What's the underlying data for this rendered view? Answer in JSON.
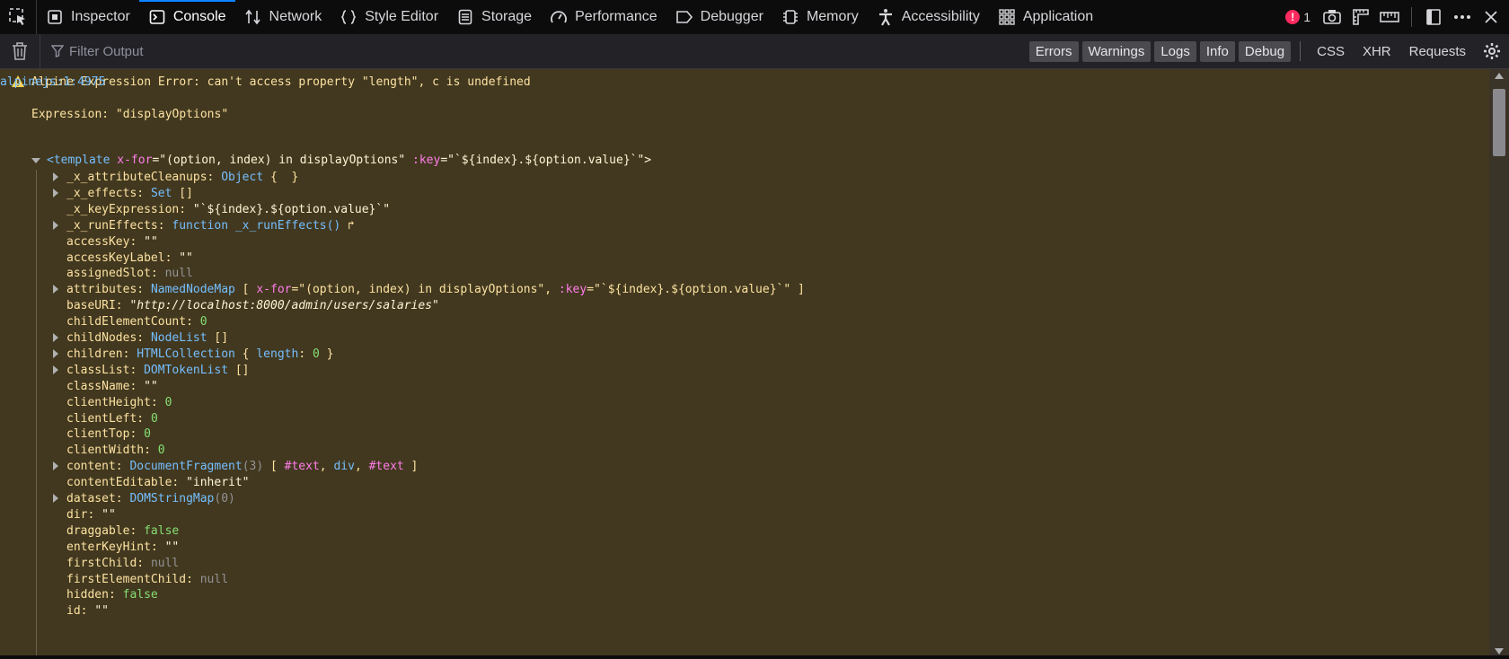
{
  "toolbar": {
    "tabs": [
      {
        "label": "Inspector",
        "icon": "inspector-icon"
      },
      {
        "label": "Console",
        "icon": "console-icon",
        "active": true
      },
      {
        "label": "Network",
        "icon": "network-icon"
      },
      {
        "label": "Style Editor",
        "icon": "style-editor-icon"
      },
      {
        "label": "Storage",
        "icon": "storage-icon"
      },
      {
        "label": "Performance",
        "icon": "performance-icon"
      },
      {
        "label": "Debugger",
        "icon": "debugger-icon"
      },
      {
        "label": "Memory",
        "icon": "memory-icon"
      },
      {
        "label": "Accessibility",
        "icon": "accessibility-icon"
      },
      {
        "label": "Application",
        "icon": "application-icon"
      }
    ],
    "error_count": "1"
  },
  "filterbar": {
    "placeholder": "Filter Output",
    "levels": [
      "Errors",
      "Warnings",
      "Logs",
      "Info",
      "Debug"
    ],
    "net_filters": [
      "CSS",
      "XHR",
      "Requests"
    ]
  },
  "console": {
    "message": "Alpine Expression Error: can't access property \"length\", c is undefined",
    "source": "alpinejs:1:4975",
    "expression": "Expression: \"displayOptions\"",
    "template_line": {
      "open": "<template ",
      "attr1": "x-for",
      "val1": "=\"(option, index) in displayOptions\" ",
      "attr2": ":key",
      "val2": "=\"`${index}.${option.value}`\">"
    },
    "props": [
      {
        "k": "_x_attributeCleanups",
        "parts": [
          {
            "c": "t",
            "v": "Object"
          },
          {
            "c": "p",
            "v": " {  }"
          }
        ],
        "tw": true
      },
      {
        "k": "_x_effects",
        "parts": [
          {
            "c": "t",
            "v": "Set"
          },
          {
            "c": "p",
            "v": " []"
          }
        ],
        "tw": true
      },
      {
        "k": "_x_keyExpression",
        "parts": [
          {
            "c": "s",
            "v": "\"`${index}.${option.value}`\""
          }
        ],
        "tw": false
      },
      {
        "k": "_x_runEffects",
        "parts": [
          {
            "c": "fn",
            "v": "function _x_runEffects()"
          },
          {
            "c": "p",
            "v": " ↱"
          }
        ],
        "tw": true
      },
      {
        "k": "accessKey",
        "parts": [
          {
            "c": "s",
            "v": "\"\""
          }
        ],
        "tw": false
      },
      {
        "k": "accessKeyLabel",
        "parts": [
          {
            "c": "s",
            "v": "\"\""
          }
        ],
        "tw": false
      },
      {
        "k": "assignedSlot",
        "parts": [
          {
            "c": "nul",
            "v": "null"
          }
        ],
        "tw": false
      },
      {
        "k": "attributes",
        "parts": [
          {
            "c": "t",
            "v": "NamedNodeMap"
          },
          {
            "c": "p",
            "v": " [ "
          },
          {
            "c": "attr",
            "v": "x-for"
          },
          {
            "c": "p",
            "v": "=\"(option, index) in displayOptions\", "
          },
          {
            "c": "attr",
            "v": ":key"
          },
          {
            "c": "p",
            "v": "=\"`${index}.${option.value}`\" ]"
          }
        ],
        "tw": true
      },
      {
        "k": "baseURI",
        "parts": [
          {
            "c": "i",
            "v": "\"http://localhost:8000/admin/users/salaries\""
          }
        ],
        "tw": false
      },
      {
        "k": "childElementCount",
        "parts": [
          {
            "c": "n",
            "v": "0"
          }
        ],
        "tw": false
      },
      {
        "k": "childNodes",
        "parts": [
          {
            "c": "t",
            "v": "NodeList"
          },
          {
            "c": "p",
            "v": " []"
          }
        ],
        "tw": true
      },
      {
        "k": "children",
        "parts": [
          {
            "c": "t",
            "v": "HTMLCollection"
          },
          {
            "c": "p",
            "v": " { "
          },
          {
            "c": "t",
            "v": "length"
          },
          {
            "c": "p",
            "v": ": "
          },
          {
            "c": "n",
            "v": "0"
          },
          {
            "c": "p",
            "v": " }"
          }
        ],
        "tw": true
      },
      {
        "k": "classList",
        "parts": [
          {
            "c": "t",
            "v": "DOMTokenList"
          },
          {
            "c": "p",
            "v": " []"
          }
        ],
        "tw": true
      },
      {
        "k": "className",
        "parts": [
          {
            "c": "s",
            "v": "\"\""
          }
        ],
        "tw": false
      },
      {
        "k": "clientHeight",
        "parts": [
          {
            "c": "n",
            "v": "0"
          }
        ],
        "tw": false
      },
      {
        "k": "clientLeft",
        "parts": [
          {
            "c": "n",
            "v": "0"
          }
        ],
        "tw": false
      },
      {
        "k": "clientTop",
        "parts": [
          {
            "c": "n",
            "v": "0"
          }
        ],
        "tw": false
      },
      {
        "k": "clientWidth",
        "parts": [
          {
            "c": "n",
            "v": "0"
          }
        ],
        "tw": false
      },
      {
        "k": "content",
        "parts": [
          {
            "c": "t",
            "v": "DocumentFragment"
          },
          {
            "c": "nul",
            "v": "(3)"
          },
          {
            "c": "p",
            "v": " [ "
          },
          {
            "c": "attr",
            "v": "#text"
          },
          {
            "c": "p",
            "v": ", "
          },
          {
            "c": "t",
            "v": "div"
          },
          {
            "c": "p",
            "v": ", "
          },
          {
            "c": "attr",
            "v": "#text"
          },
          {
            "c": "p",
            "v": " ]"
          }
        ],
        "tw": true
      },
      {
        "k": "contentEditable",
        "parts": [
          {
            "c": "s",
            "v": "\"inherit\""
          }
        ],
        "tw": false
      },
      {
        "k": "dataset",
        "parts": [
          {
            "c": "t",
            "v": "DOMStringMap"
          },
          {
            "c": "nul",
            "v": "(0)"
          }
        ],
        "tw": true
      },
      {
        "k": "dir",
        "parts": [
          {
            "c": "s",
            "v": "\"\""
          }
        ],
        "tw": false
      },
      {
        "k": "draggable",
        "parts": [
          {
            "c": "n",
            "v": "false"
          }
        ],
        "tw": false
      },
      {
        "k": "enterKeyHint",
        "parts": [
          {
            "c": "s",
            "v": "\"\""
          }
        ],
        "tw": false
      },
      {
        "k": "firstChild",
        "parts": [
          {
            "c": "nul",
            "v": "null"
          }
        ],
        "tw": false
      },
      {
        "k": "firstElementChild",
        "parts": [
          {
            "c": "nul",
            "v": "null"
          }
        ],
        "tw": false
      },
      {
        "k": "hidden",
        "parts": [
          {
            "c": "n",
            "v": "false"
          }
        ],
        "tw": false
      },
      {
        "k": "id",
        "parts": [
          {
            "c": "s",
            "v": "\"\""
          }
        ],
        "tw": false
      }
    ]
  }
}
